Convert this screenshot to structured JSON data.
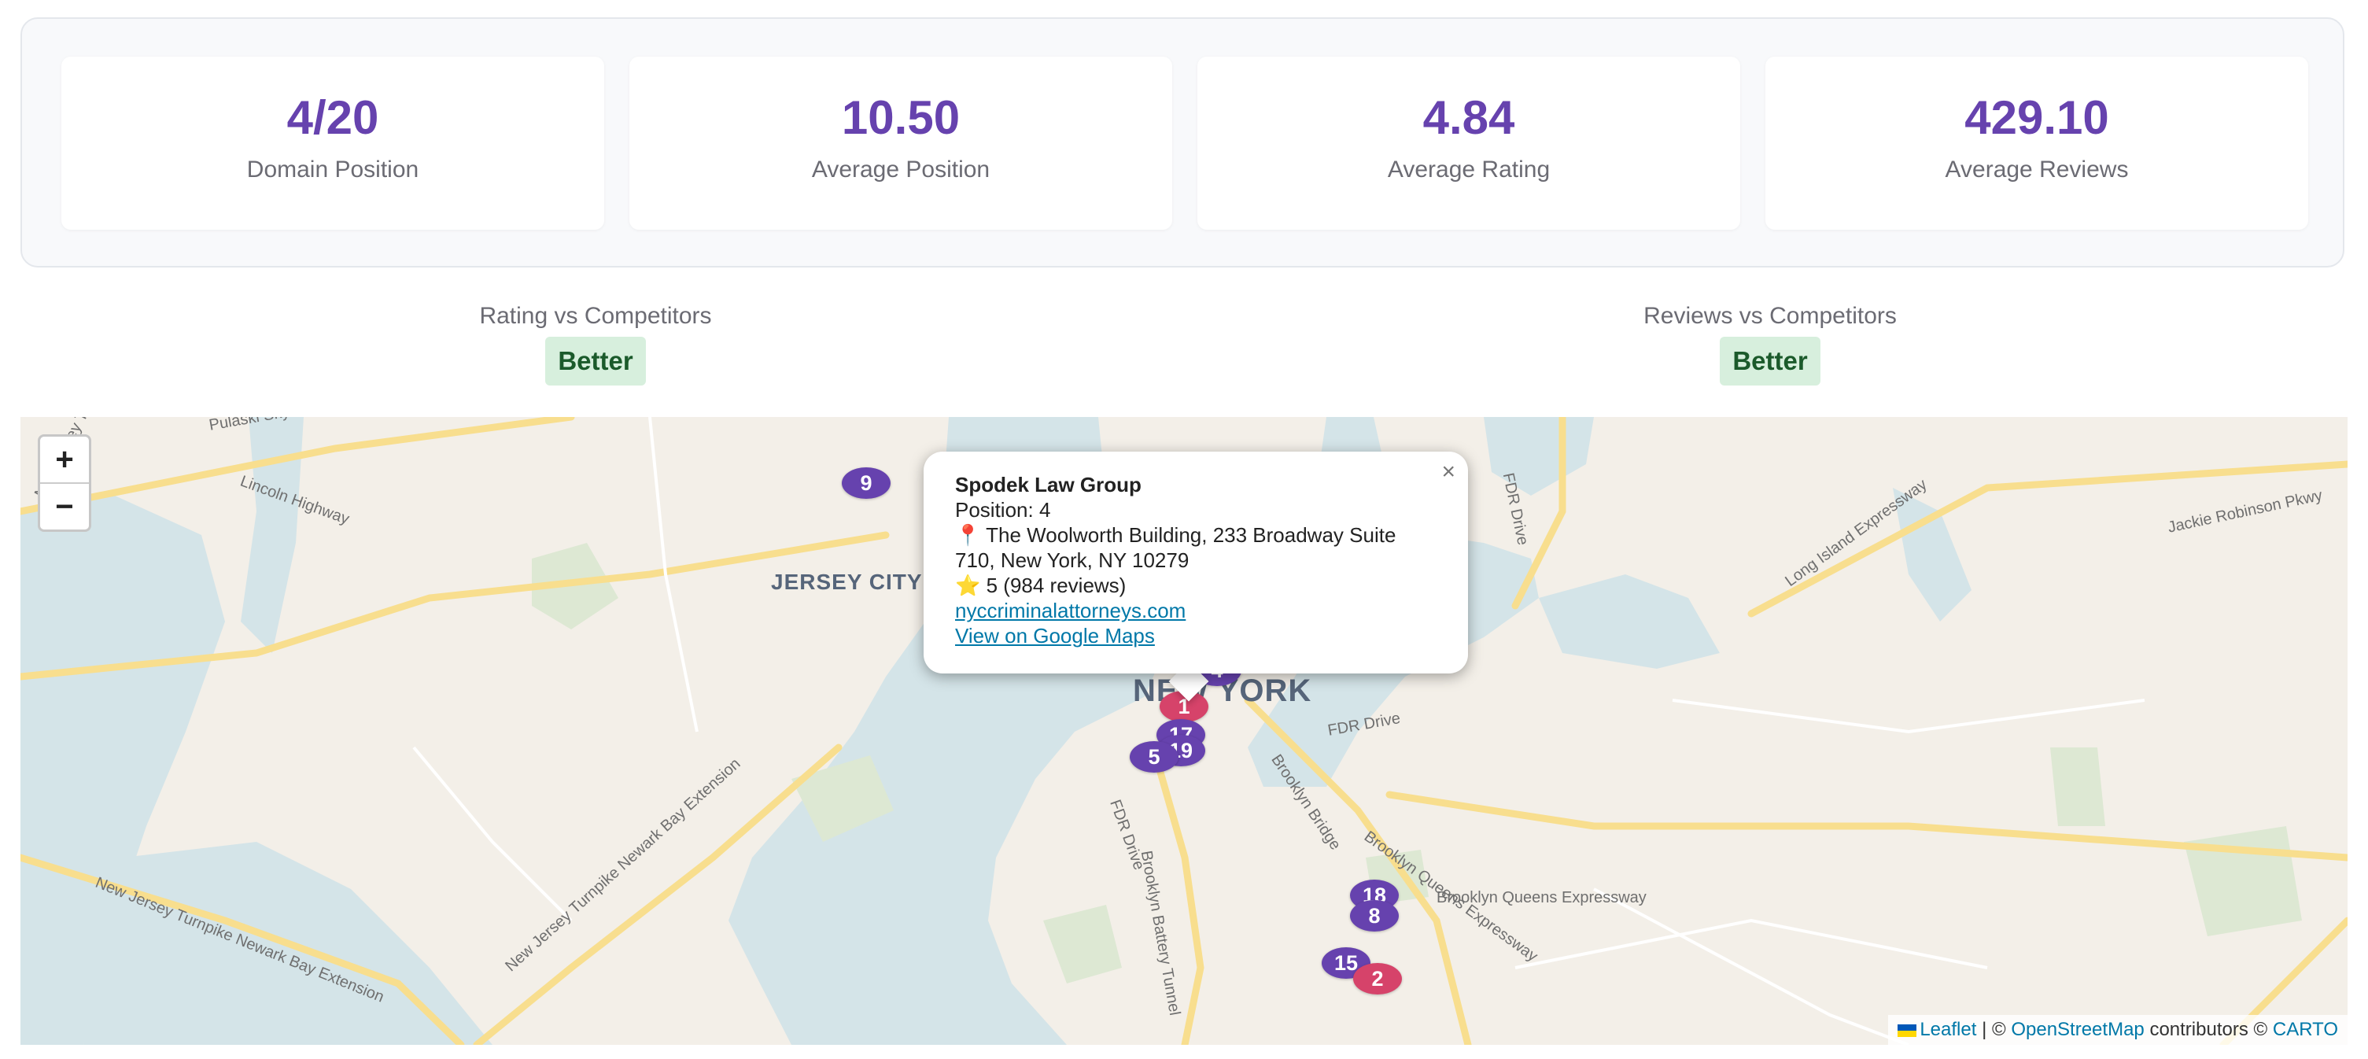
{
  "stats": [
    {
      "value": "4/20",
      "label": "Domain Position"
    },
    {
      "value": "10.50",
      "label": "Average Position"
    },
    {
      "value": "4.84",
      "label": "Average Rating"
    },
    {
      "value": "429.10",
      "label": "Average Reviews"
    }
  ],
  "comparisons": [
    {
      "title": "Rating vs Competitors",
      "badge": "Better"
    },
    {
      "title": "Reviews vs Competitors",
      "badge": "Better"
    }
  ],
  "map": {
    "zoom_in": "+",
    "zoom_out": "−",
    "place_labels": [
      "JERSEY CITY",
      "NEW YORK"
    ],
    "road_labels": [
      "Pulaski Skyway",
      "Lincoln Highway",
      "New Jersey Turnpike",
      "New Jersey Turnpike Newark Bay Extension",
      "New Jersey Turnpike Newark Bay Extension",
      "FDR Drive",
      "FDR Drive",
      "FDR Drive",
      "Brooklyn Bridge",
      "Brooklyn Queens Expressway",
      "Brooklyn Queens Expressway",
      "Brooklyn Battery Tunnel",
      "Long Island Expressway",
      "Jackie Robinson Pkwy"
    ],
    "markers": [
      {
        "label": "9",
        "color": "purple"
      },
      {
        "label": "4",
        "color": "purple"
      },
      {
        "label": "1",
        "color": "pink"
      },
      {
        "label": "17",
        "color": "purple"
      },
      {
        "label": "19",
        "color": "purple"
      },
      {
        "label": "5",
        "color": "purple"
      },
      {
        "label": "18",
        "color": "purple"
      },
      {
        "label": "8",
        "color": "purple"
      },
      {
        "label": "15",
        "color": "purple"
      },
      {
        "label": "2",
        "color": "pink"
      }
    ],
    "popup": {
      "name": "Spodek Law Group",
      "position_line": "Position: 4",
      "pin_icon": "📍",
      "address_line1": "The Woolworth Building, 233 Broadway Suite",
      "address_line2": "710, New York, NY 10279",
      "star_icon": "⭐",
      "rating_line": "5 (984 reviews)",
      "website": "nyccriminalattorneys.com",
      "maps_link": "View on Google Maps",
      "close": "×"
    },
    "attribution": {
      "leaflet": "Leaflet",
      "sep": "|",
      "copy1": "©",
      "osm": "OpenStreetMap",
      "contributors": "contributors ©",
      "carto": "CARTO"
    }
  },
  "colors": {
    "accent": "#6642ae",
    "marker_purple": "#6642ae",
    "marker_pink": "#d6436a",
    "badge_bg": "#d7efdd",
    "badge_text": "#1b5a2b",
    "link": "#0078a8",
    "water": "#d4e4e8",
    "land": "#f3efe8",
    "park": "#dde8d3"
  }
}
